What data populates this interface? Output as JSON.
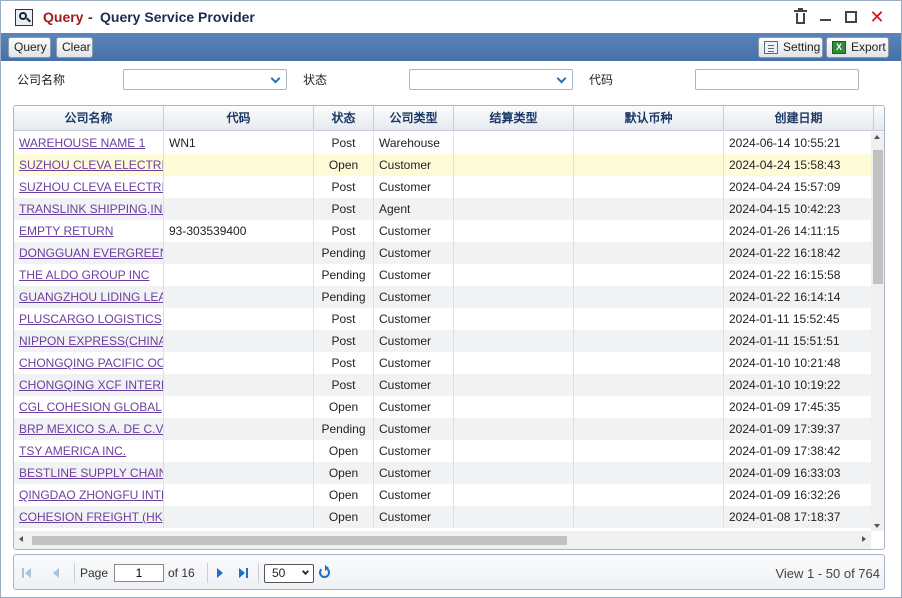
{
  "window": {
    "title_main": "Query",
    "title_sep": "-",
    "title_sub": "Query Service Provider"
  },
  "toolbar": {
    "query_label": "Query",
    "clear_label": "Clear",
    "setting_label": "Setting",
    "export_label": "Export",
    "excel_icon_text": "X"
  },
  "filters": {
    "company_label": "公司名称",
    "company_value": "",
    "status_label": "状态",
    "status_value": "",
    "code_label": "代码",
    "code_value": ""
  },
  "grid": {
    "columns": [
      "公司名称",
      "代码",
      "状态",
      "公司类型",
      "结算类型",
      "默认币种",
      "创建日期"
    ],
    "rows": [
      {
        "name": "WAREHOUSE NAME 1",
        "code": "WN1",
        "status": "Post",
        "type": "Warehouse",
        "settle": "",
        "currency": "",
        "created": "2024-06-14 10:55:21"
      },
      {
        "name": "SUZHOU CLEVA ELECTRIC",
        "code": "",
        "status": "Open",
        "type": "Customer",
        "settle": "",
        "currency": "",
        "created": "2024-04-24 15:58:43"
      },
      {
        "name": "SUZHOU CLEVA ELECTRIC",
        "code": "",
        "status": "Post",
        "type": "Customer",
        "settle": "",
        "currency": "",
        "created": "2024-04-24 15:57:09"
      },
      {
        "name": "TRANSLINK SHIPPING,INC",
        "code": "",
        "status": "Post",
        "type": "Agent",
        "settle": "",
        "currency": "",
        "created": "2024-04-15 10:42:23"
      },
      {
        "name": "EMPTY RETURN",
        "code": "93-303539400",
        "status": "Post",
        "type": "Customer",
        "settle": "",
        "currency": "",
        "created": "2024-01-26 14:11:15"
      },
      {
        "name": "DONGGUAN EVERGREEN",
        "code": "",
        "status": "Pending",
        "type": "Customer",
        "settle": "",
        "currency": "",
        "created": "2024-01-22 16:18:42"
      },
      {
        "name": "THE ALDO GROUP INC",
        "code": "",
        "status": "Pending",
        "type": "Customer",
        "settle": "",
        "currency": "",
        "created": "2024-01-22 16:15:58"
      },
      {
        "name": "GUANGZHOU LIDING LEATHER",
        "code": "",
        "status": "Pending",
        "type": "Customer",
        "settle": "",
        "currency": "",
        "created": "2024-01-22 16:14:14"
      },
      {
        "name": "PLUSCARGO LOGISTICS",
        "code": "",
        "status": "Post",
        "type": "Customer",
        "settle": "",
        "currency": "",
        "created": "2024-01-11 15:52:45"
      },
      {
        "name": "NIPPON EXPRESS(CHINA)",
        "code": "",
        "status": "Post",
        "type": "Customer",
        "settle": "",
        "currency": "",
        "created": "2024-01-11 15:51:51"
      },
      {
        "name": "CHONGQING PACIFIC OCEAN",
        "code": "",
        "status": "Post",
        "type": "Customer",
        "settle": "",
        "currency": "",
        "created": "2024-01-10 10:21:48"
      },
      {
        "name": "CHONGQING XCF INTERNATIONAL",
        "code": "",
        "status": "Post",
        "type": "Customer",
        "settle": "",
        "currency": "",
        "created": "2024-01-10 10:19:22"
      },
      {
        "name": "CGL COHESION GLOBAL",
        "code": "",
        "status": "Open",
        "type": "Customer",
        "settle": "",
        "currency": "",
        "created": "2024-01-09 17:45:35"
      },
      {
        "name": "BRP MEXICO S.A. DE C.V.",
        "code": "",
        "status": "Pending",
        "type": "Customer",
        "settle": "",
        "currency": "",
        "created": "2024-01-09 17:39:37"
      },
      {
        "name": "TSY AMERICA INC.",
        "code": "",
        "status": "Open",
        "type": "Customer",
        "settle": "",
        "currency": "",
        "created": "2024-01-09 17:38:42"
      },
      {
        "name": "BESTLINE SUPPLY CHAIN",
        "code": "",
        "status": "Open",
        "type": "Customer",
        "settle": "",
        "currency": "",
        "created": "2024-01-09 16:33:03"
      },
      {
        "name": "QINGDAO ZHONGFU INTERNATIONAL",
        "code": "",
        "status": "Open",
        "type": "Customer",
        "settle": "",
        "currency": "",
        "created": "2024-01-09 16:32:26"
      },
      {
        "name": "COHESION FREIGHT (HK)",
        "code": "",
        "status": "Open",
        "type": "Customer",
        "settle": "",
        "currency": "",
        "created": "2024-01-08 17:18:37"
      }
    ]
  },
  "pager": {
    "page_label": "Page",
    "page_value": "1",
    "of_label": "of 16",
    "page_size": "50",
    "view_text": "View 1 - 50 of 764"
  },
  "colors": {
    "toolbar": "#4f78ad",
    "title_main": "#a11d1d",
    "link": "#6b3fa0",
    "header_text": "#1d3a66",
    "highlight_row": "#fdfbd8"
  }
}
